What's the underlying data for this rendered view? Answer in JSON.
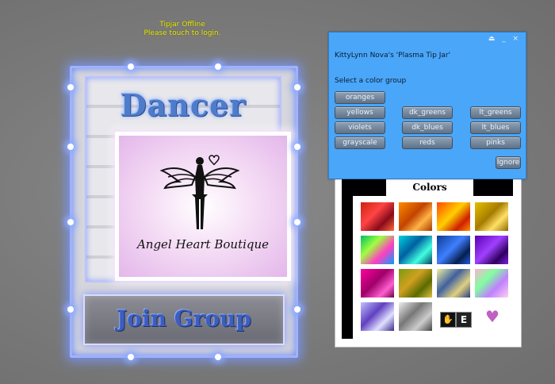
{
  "hover_text": {
    "line1": "Tipjar Offline",
    "line2": "Please touch to login."
  },
  "sign": {
    "title": "Dancer",
    "brand": "Angel Heart Boutique",
    "join_label": "Join Group",
    "glow_color": "#7f9cff"
  },
  "colors_board": {
    "label": "Colors"
  },
  "dialog": {
    "title": "KittyLynn Nova's 'Plasma Tip Jar'",
    "prompt": "Select a color group",
    "controls": "⏏ _ ×",
    "buttons": [
      {
        "label": "oranges"
      },
      {
        "label": "yellows"
      },
      {
        "label": "dk_greens"
      },
      {
        "label": "lt_greens"
      },
      {
        "label": "violets"
      },
      {
        "label": "dk_blues"
      },
      {
        "label": "lt_blues"
      },
      {
        "label": "grayscale"
      },
      {
        "label": "reds"
      },
      {
        "label": "pinks"
      }
    ],
    "ignore_label": "Ignore",
    "background": "#4aa6f8"
  }
}
